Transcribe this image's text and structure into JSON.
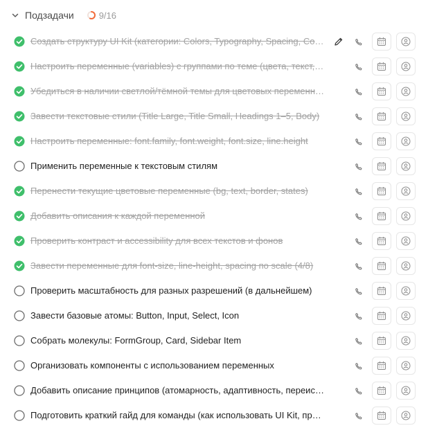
{
  "header": {
    "title": "Подзадачи",
    "progress_text": "9/16",
    "progress_fraction": 0.5625,
    "progress_color": "#f26b3a"
  },
  "colors": {
    "done_check": "#3fbf6b",
    "open_circle": "#6b6b6b",
    "done_text": "#a3a3a3",
    "text": "#1f1f1f"
  },
  "subtasks": [
    {
      "title": "Создать структуру UI Kit (категории: Colors, Typography, Spacing, Components)",
      "done": true,
      "show_edit": true
    },
    {
      "title": "Настроить переменные (variables) с группами по теме (цвета, текст, отступы)",
      "done": true,
      "show_edit": false
    },
    {
      "title": "Убедиться в наличии светлой/тёмной темы для цветовых переменных",
      "done": true,
      "show_edit": false
    },
    {
      "title": "Завести текстовые стили (Title Large, Title Small, Headings 1–5, Body)",
      "done": true,
      "show_edit": false
    },
    {
      "title": "Настроить переменные: font.family, font.weight, font.size, line.height",
      "done": true,
      "show_edit": false
    },
    {
      "title": "Применить переменные к текстовым стилям",
      "done": false,
      "show_edit": false
    },
    {
      "title": "Перенести текущие цветовые переменные (bg, text, border, states)",
      "done": true,
      "show_edit": false
    },
    {
      "title": "Добавить описания к каждой переменной",
      "done": true,
      "show_edit": false
    },
    {
      "title": "Проверить контраст и accessibility для всех текстов и фонов",
      "done": true,
      "show_edit": false
    },
    {
      "title": "Завести переменные для font-size, line-height, spacing по scale (4/8)",
      "done": true,
      "show_edit": false
    },
    {
      "title": "Проверить масштабность для разных разрешений (в дальнейшем)",
      "done": false,
      "show_edit": false
    },
    {
      "title": "Завести базовые атомы: Button, Input, Select, Icon",
      "done": false,
      "show_edit": false
    },
    {
      "title": "Собрать молекулы: FormGroup, Card, Sidebar Item",
      "done": false,
      "show_edit": false
    },
    {
      "title": "Организовать компоненты с использованием переменных",
      "done": false,
      "show_edit": false
    },
    {
      "title": "Добавить описание принципов (атомарность, адаптивность, переиспользование)",
      "done": false,
      "show_edit": false
    },
    {
      "title": "Подготовить краткий гайд для команды (как использовать UI Kit, правила)",
      "done": false,
      "show_edit": false
    }
  ]
}
